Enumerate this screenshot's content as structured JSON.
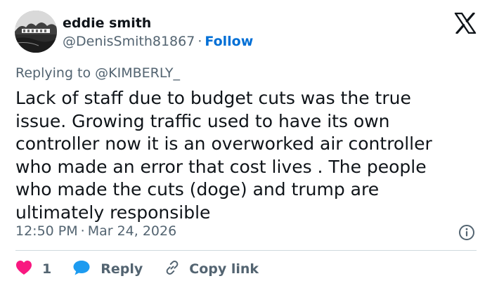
{
  "user": {
    "display_name": "eddie smith",
    "handle": "@DenisSmith81867",
    "separator": "·",
    "follow_label": "Follow"
  },
  "reply_context": {
    "prefix": "Replying to ",
    "mention": "@KIMBERLY_"
  },
  "tweet": {
    "text": "Lack of staff due to budget cuts was the true issue. Growing traffic used to have its own controller now it is an overworked air controller who made an error that cost lives . The people who made the cuts (doge) and trump are ultimately responsible",
    "time": "12:50 PM",
    "separator": "·",
    "date": "Mar 24, 2026"
  },
  "actions": {
    "like_count": "1",
    "reply_label": "Reply",
    "copy_link_label": "Copy link"
  },
  "colors": {
    "text_primary": "#0f1419",
    "text_secondary": "#536471",
    "link_blue": "#006fd6",
    "like_pink": "#f91880",
    "reply_blue": "#1d9bf0",
    "divider": "#cfd9de"
  },
  "icons": {
    "brand": "x-logo-icon",
    "info": "info-icon",
    "like": "heart-icon",
    "reply": "speech-bubble-icon",
    "copy": "link-icon"
  }
}
